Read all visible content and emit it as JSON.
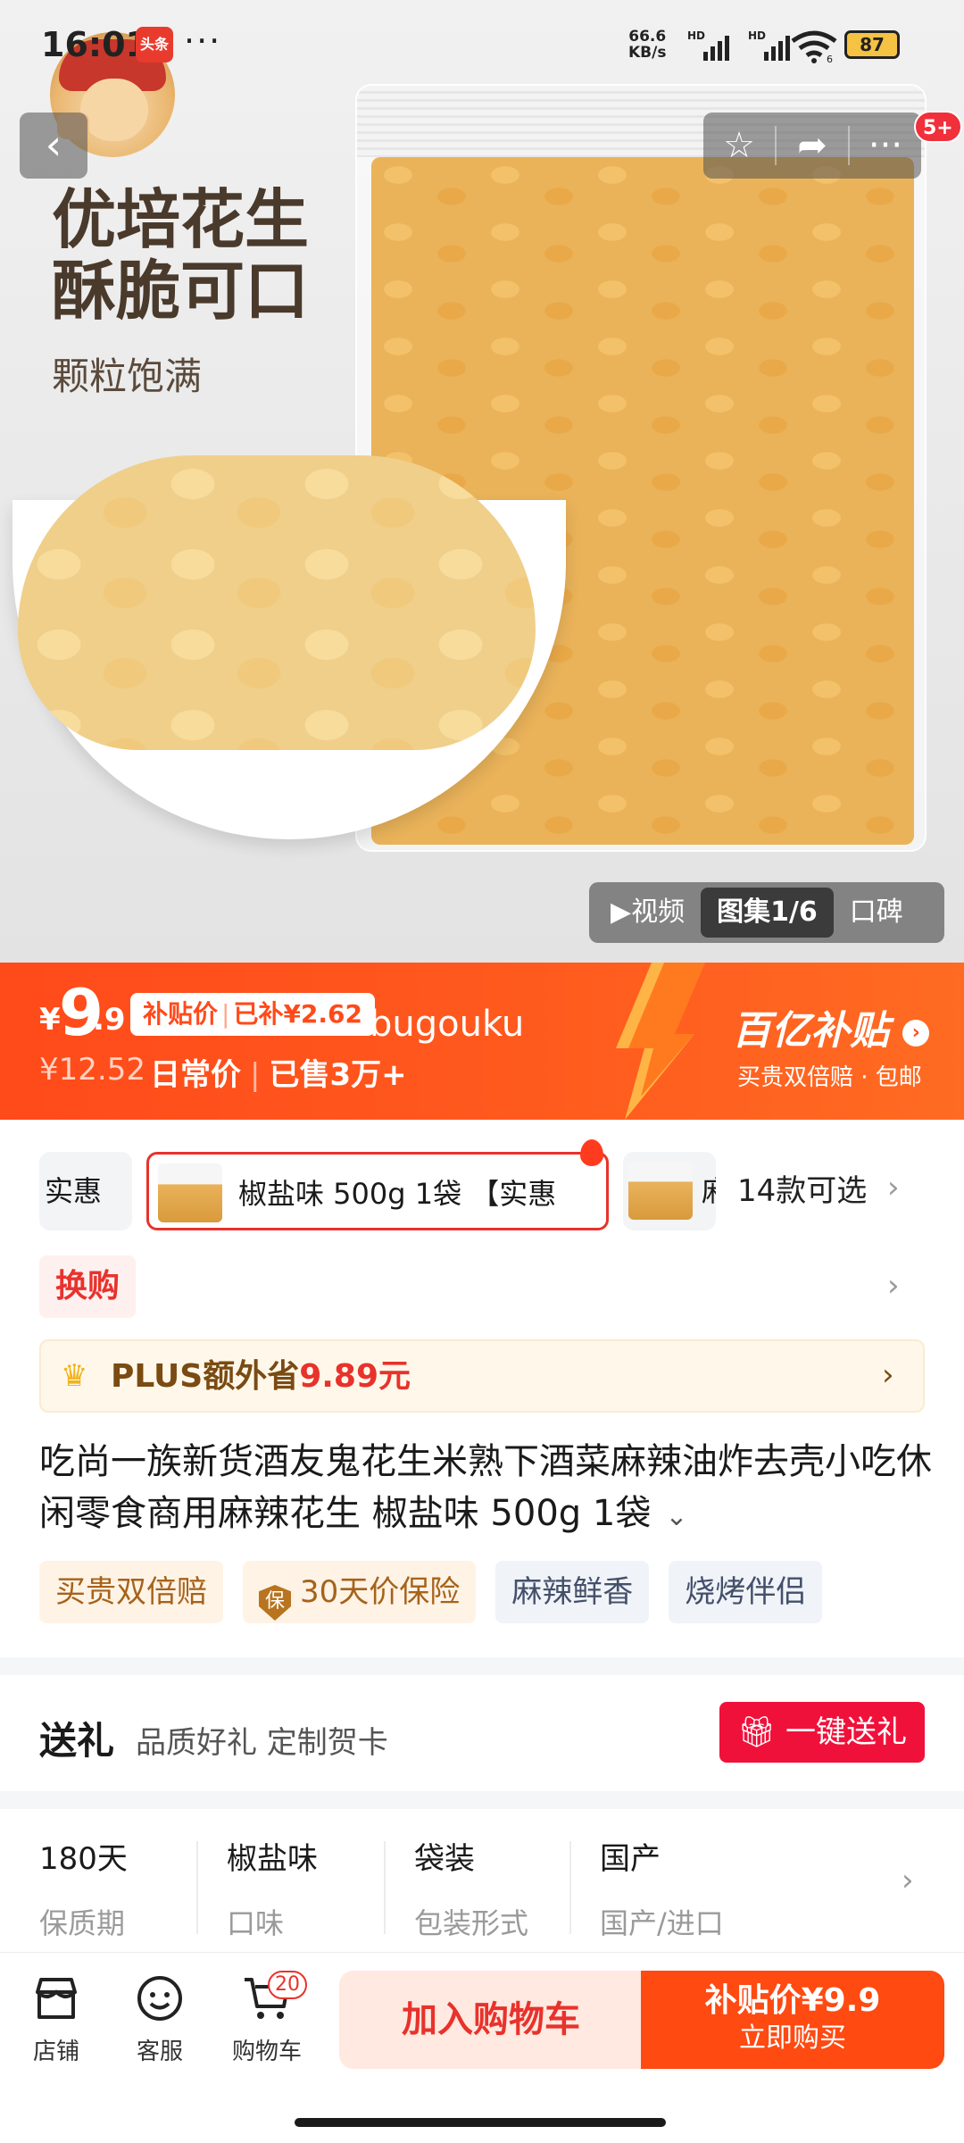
{
  "status_bar": {
    "time": "16:01",
    "app_badge": "头条",
    "more": "···",
    "net_speed_value": "66.6",
    "net_speed_unit": "KB/s",
    "signal_1": "HD",
    "signal_2": "HD",
    "wifi_badge": "6",
    "battery": "87"
  },
  "top_actions": {
    "back": "‹",
    "favorite": "☆",
    "share": "➦",
    "more": "···",
    "message_badge": "5+"
  },
  "hero": {
    "title_line1": "优培花生",
    "title_line2": "酥脆可口",
    "subtitle": "颗粒饱满",
    "media_tabs": [
      "▶视频",
      "图集1/6",
      "口碑"
    ],
    "media_active_index": 1
  },
  "price": {
    "currency": "¥",
    "integer": "9",
    "decimal": ".9",
    "subsidy_label": "补贴价",
    "subsidy_amount": "已补¥2.62",
    "watermark": "bugouku",
    "original_price": "¥12.52",
    "daily_label": "日常价",
    "sold": "已售3万+",
    "brand": "百亿补贴",
    "brand_sub": "买贵双倍赔 · 包邮"
  },
  "sku": {
    "chip_prev": "实惠",
    "chip_selected": "椒盐味 500g 1袋 【实惠",
    "chip_next": "麻",
    "count": "14款可选"
  },
  "swap": "换购",
  "plus": {
    "text": "PLUS额外省",
    "amount": "9.89元"
  },
  "product_title": "吃尚一族新货酒友鬼花生米熟下酒菜麻辣油炸去壳小吃休闲零食商用麻辣花生 椒盐味 500g 1袋",
  "tags": [
    "买贵双倍赔",
    "30天价保险",
    "麻辣鲜香",
    "烧烤伴侣"
  ],
  "shield_char": "保",
  "gift": {
    "title": "送礼",
    "subtitle": "品质好礼 定制贺卡",
    "button": "一键送礼"
  },
  "specs": [
    {
      "value": "180天",
      "key": "保质期"
    },
    {
      "value": "椒盐味",
      "key": "口味"
    },
    {
      "value": "袋装",
      "key": "包装形式"
    },
    {
      "value": "国产",
      "key": "国产/进口"
    }
  ],
  "bottom_nav": {
    "store": "店铺",
    "service": "客服",
    "cart": "购物车",
    "cart_badge": "20",
    "add_to_cart": "加入购物车",
    "buy_line1": "补贴价¥9.9",
    "buy_line2": "立即购买"
  },
  "colors": {
    "accent_red": "#e8322c",
    "price_orange": "#ff4a1a",
    "gift_red": "#f0113b"
  }
}
